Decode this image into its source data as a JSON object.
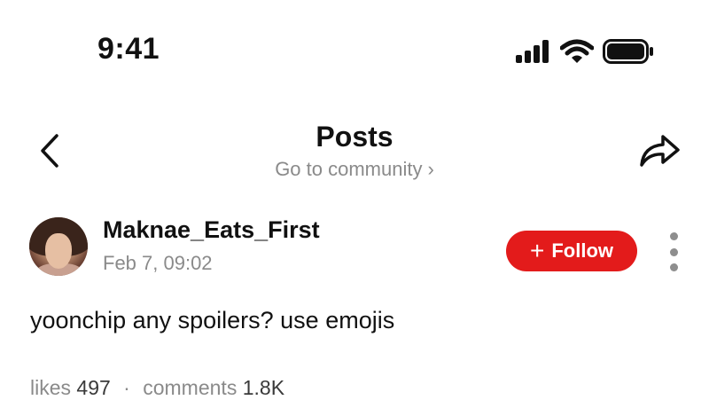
{
  "status_bar": {
    "time": "9:41",
    "icons": [
      "signal-icon",
      "wifi-icon",
      "battery-icon"
    ]
  },
  "header": {
    "title": "Posts",
    "community_link": "Go to community",
    "back_icon": "chevron-left-icon",
    "share_icon": "share-arrow-icon"
  },
  "post": {
    "author": {
      "username": "Maknae_Eats_First",
      "date": "Feb 7, 09:02"
    },
    "follow_label": "Follow",
    "text": "yoonchip any spoilers? use emojis",
    "stats": {
      "likes_label": "likes",
      "likes_count": "497",
      "separator": "·",
      "comments_label": "comments",
      "comments_count": "1.8K"
    }
  },
  "colors": {
    "accent": "#e31b1b",
    "muted_text": "#8a8a8a",
    "primary_text": "#111111"
  }
}
